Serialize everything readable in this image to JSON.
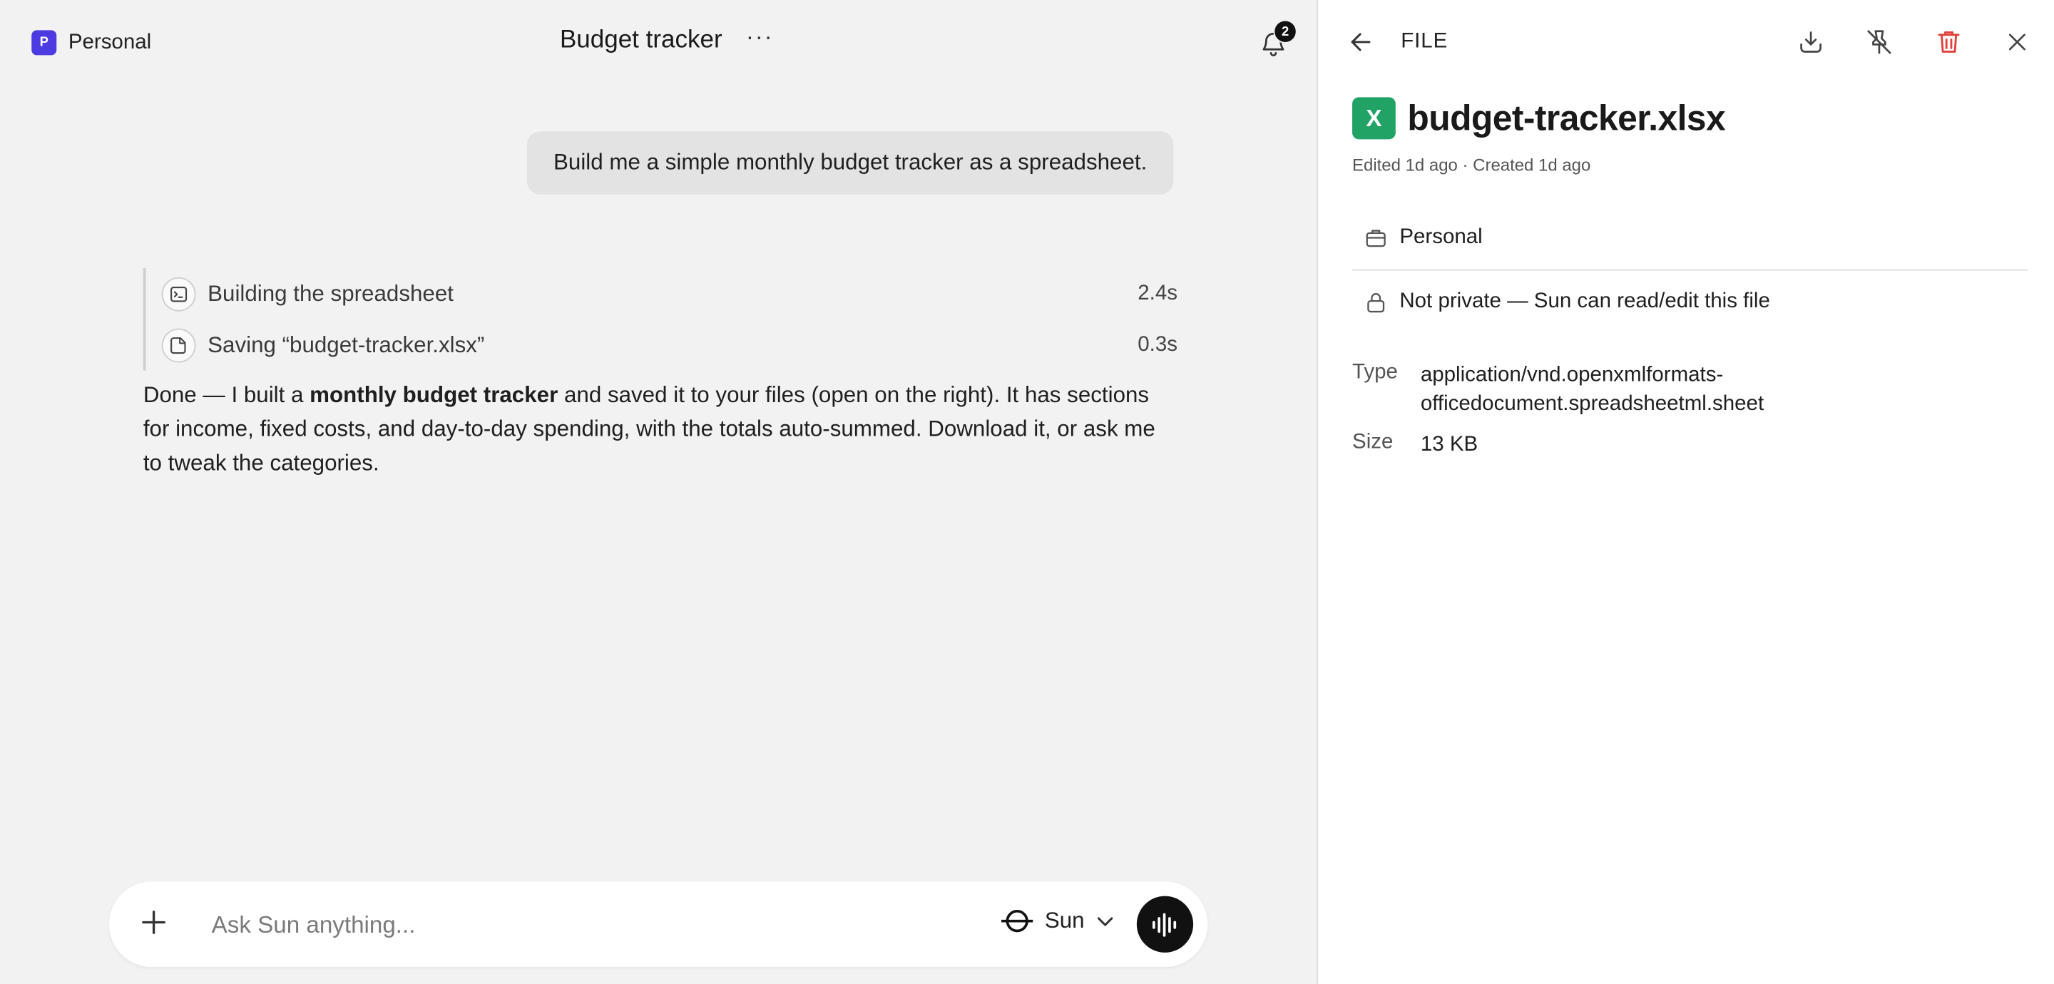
{
  "workspace": {
    "badge": "P",
    "name": "Personal"
  },
  "header": {
    "title": "Budget tracker",
    "more_label": "···",
    "notification_count": "2"
  },
  "chat": {
    "user_message": "Build me a simple monthly budget tracker as a spreadsheet.",
    "steps": [
      {
        "label": "Building the spreadsheet",
        "time": "2.4s",
        "icon": "terminal-icon"
      },
      {
        "label": "Saving “budget-tracker.xlsx”",
        "time": "0.3s",
        "icon": "save-file-icon"
      }
    ],
    "reply": {
      "pre": "Done — I built a ",
      "bold": "monthly budget tracker",
      "post": " and saved it to your files (open on the right). It has sections for income, fixed costs, and day-to-day spending, with the totals auto-summed. Download it, or ask me to tweak the categories."
    }
  },
  "composer": {
    "placeholder": "Ask Sun anything...",
    "value": "",
    "model": "Sun"
  },
  "file_panel": {
    "label": "FILE",
    "icon_letter": "X",
    "file_name": "budget-tracker.xlsx",
    "meta": "Edited 1d ago · Created 1d ago",
    "space": "Personal",
    "privacy": "Not private — Sun can read/edit this file",
    "type_label": "Type",
    "type_value_line1": "application/vnd.openxmlformats-",
    "type_value_line2": "officedocument.spreadsheetml.sheet",
    "size_label": "Size",
    "size_value": "13 KB"
  },
  "colors": {
    "workspace_badge": "#4b3be0",
    "excel_green": "#21a366",
    "delete_red": "#e0413b",
    "panel_bg": "#ffffff",
    "chat_bg": "#f2f2f2"
  }
}
